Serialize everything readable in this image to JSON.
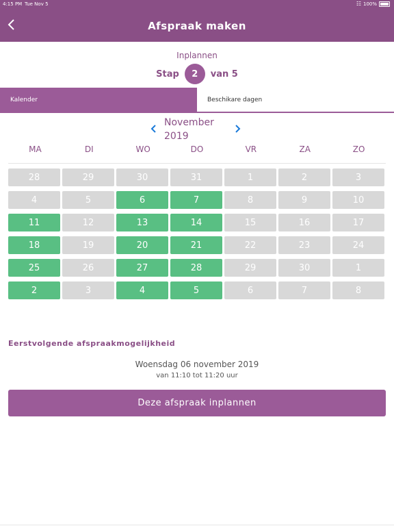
{
  "status": {
    "time": "4:15 PM",
    "date": "Tue Nov 5",
    "battery": "100%"
  },
  "header": {
    "title": "Afspraak maken",
    "back_icon": "chevron-left-icon"
  },
  "progress": {
    "label": "Inplannen",
    "step_prefix": "Stap",
    "step_current": "2",
    "step_suffix": "van 5"
  },
  "tabs": [
    {
      "label": "Kalender",
      "active": true
    },
    {
      "label": "Beschikare dagen",
      "active": false
    }
  ],
  "calendar": {
    "month": "November",
    "year": "2019",
    "prev_icon": "chevron-left-icon",
    "next_icon": "chevron-right-icon",
    "weekdays": [
      "MA",
      "DI",
      "WO",
      "DO",
      "VR",
      "ZA",
      "ZO"
    ],
    "weeks": [
      [
        {
          "day": "28",
          "available": false
        },
        {
          "day": "29",
          "available": false
        },
        {
          "day": "30",
          "available": false
        },
        {
          "day": "31",
          "available": false
        },
        {
          "day": "1",
          "available": false
        },
        {
          "day": "2",
          "available": false
        },
        {
          "day": "3",
          "available": false
        }
      ],
      [
        {
          "day": "4",
          "available": false
        },
        {
          "day": "5",
          "available": false
        },
        {
          "day": "6",
          "available": true
        },
        {
          "day": "7",
          "available": true
        },
        {
          "day": "8",
          "available": false
        },
        {
          "day": "9",
          "available": false
        },
        {
          "day": "10",
          "available": false
        }
      ],
      [
        {
          "day": "11",
          "available": true
        },
        {
          "day": "12",
          "available": false
        },
        {
          "day": "13",
          "available": true
        },
        {
          "day": "14",
          "available": true
        },
        {
          "day": "15",
          "available": false
        },
        {
          "day": "16",
          "available": false
        },
        {
          "day": "17",
          "available": false
        }
      ],
      [
        {
          "day": "18",
          "available": true
        },
        {
          "day": "19",
          "available": false
        },
        {
          "day": "20",
          "available": true
        },
        {
          "day": "21",
          "available": true
        },
        {
          "day": "22",
          "available": false
        },
        {
          "day": "23",
          "available": false
        },
        {
          "day": "24",
          "available": false
        }
      ],
      [
        {
          "day": "25",
          "available": true
        },
        {
          "day": "26",
          "available": false
        },
        {
          "day": "27",
          "available": true
        },
        {
          "day": "28",
          "available": true
        },
        {
          "day": "29",
          "available": false
        },
        {
          "day": "30",
          "available": false
        },
        {
          "day": "1",
          "available": false
        }
      ],
      [
        {
          "day": "2",
          "available": true
        },
        {
          "day": "3",
          "available": false
        },
        {
          "day": "4",
          "available": true
        },
        {
          "day": "5",
          "available": true
        },
        {
          "day": "6",
          "available": false
        },
        {
          "day": "7",
          "available": false
        },
        {
          "day": "8",
          "available": false
        }
      ]
    ]
  },
  "next_appointment": {
    "heading": "Eerstvolgende afspraakmogelijkheid",
    "date": "Woensdag 06 november 2019",
    "time": "van 11:10 tot 11:20 uur",
    "button_label": "Deze afspraak inplannen"
  },
  "colors": {
    "header": "#8a4f86",
    "accent": "#9b5b98",
    "available": "#59bf83",
    "unavailable": "#d8d8d8",
    "nav_arrow": "#1a7ad9"
  }
}
